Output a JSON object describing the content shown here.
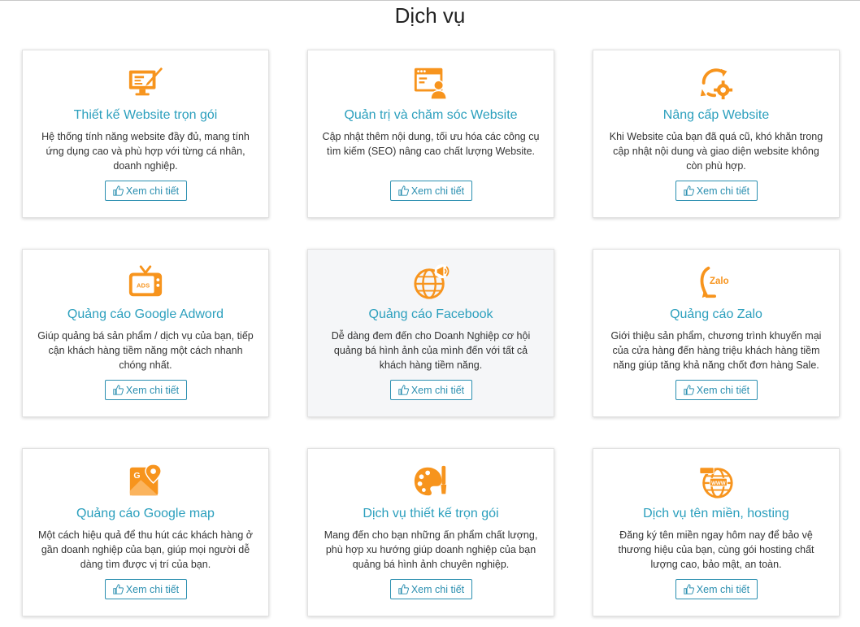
{
  "page": {
    "title": "Dịch vụ"
  },
  "colors": {
    "accent": "#f7941d",
    "title": "#2b9fbd",
    "button": "#2b8fb0"
  },
  "button_icon": "thumbs-up-icon",
  "services": [
    {
      "icon": "website-design-icon",
      "title": "Thiết kế Website trọn gói",
      "desc": "Hệ thống tính năng website đầy đủ, mang tính ứng dụng cao và phù hợp với từng cá nhân, doanh nghiệp.",
      "button": "Xem chi tiết"
    },
    {
      "icon": "website-admin-icon",
      "title": "Quản trị và chăm sóc Website",
      "desc": "Cập nhật thêm nội dung, tối ưu hóa các công cụ tìm kiếm (SEO) nâng cao chất lượng Website.",
      "button": "Xem chi tiết"
    },
    {
      "icon": "upgrade-gear-icon",
      "title": "Nâng cấp Website",
      "desc": "Khi Website của bạn đã quá cũ, khó khăn trong cập nhật nội dung và giao diện website không còn phù hợp.",
      "button": "Xem chi tiết"
    },
    {
      "icon": "ads-tv-icon",
      "title": "Quảng cáo Google Adword",
      "desc": "Giúp quảng bá sản phẩm / dịch vụ của bạn, tiếp cận khách hàng tiềm năng một cách nhanh chóng nhất.",
      "button": "Xem chi tiết"
    },
    {
      "icon": "globe-megaphone-icon",
      "title": "Quảng cáo Facebook",
      "desc": "Dễ dàng đem đến cho Doanh Nghiệp cơ hội quảng bá hình ảnh của mình đến với tất cả khách hàng tiềm năng.",
      "button": "Xem chi tiết"
    },
    {
      "icon": "zalo-icon",
      "title": "Quảng cáo Zalo",
      "desc": "Giới thiệu sản phẩm, chương trình khuyến mại của cửa hàng đến hàng triệu khách hàng tiềm năng giúp tăng khả năng chốt đơn hàng Sale.",
      "button": "Xem chi tiết"
    },
    {
      "icon": "google-map-icon",
      "title": "Quảng cáo Google map",
      "desc": "Một cách hiệu quả để thu hút các khách hàng ở gần doanh nghiệp của bạn, giúp mọi người dễ dàng tìm được vị trí của bạn.",
      "button": "Xem chi tiết"
    },
    {
      "icon": "palette-icon",
      "title": "Dịch vụ thiết kế trọn gói",
      "desc": "Mang đến cho bạn những ấn phẩm chất lượng, phù hợp xu hướng giúp doanh nghiệp của bạn quảng bá hình ảnh chuyên nghiệp.",
      "button": "Xem chi tiết"
    },
    {
      "icon": "www-globe-icon",
      "title": "Dịch vụ tên miền, hosting",
      "desc": "Đăng ký tên miền ngay hôm nay để bảo vệ thương hiệu của bạn, cùng gói hosting chất lượng cao, bảo mật, an toàn.",
      "button": "Xem chi tiết"
    }
  ]
}
